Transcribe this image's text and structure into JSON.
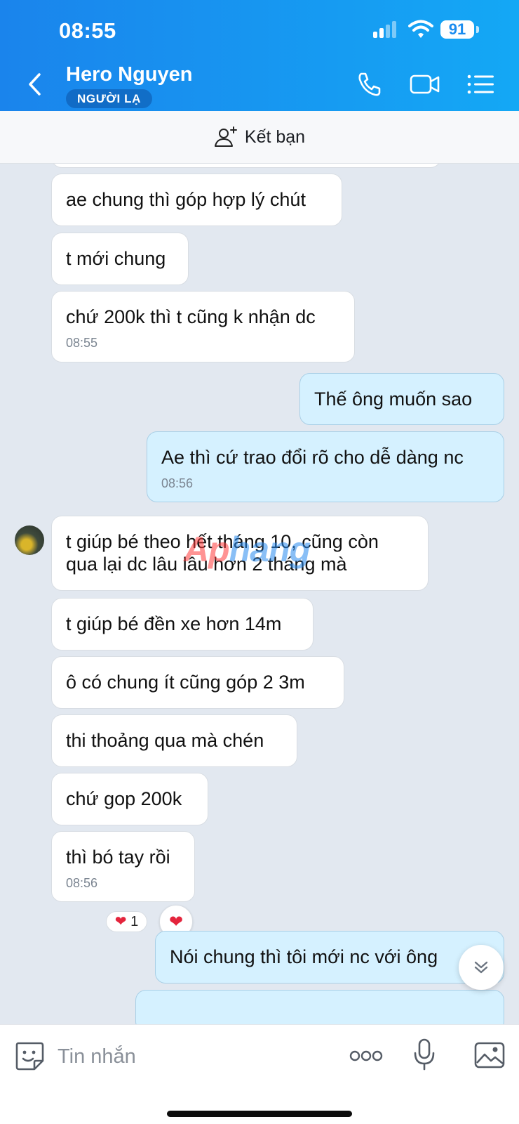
{
  "status_bar": {
    "time": "08:55",
    "battery": "91"
  },
  "header": {
    "contact_name": "Hero Nguyen",
    "badge": "NGƯỜI LẠ"
  },
  "add_friend": {
    "label": "Kết bạn"
  },
  "messages": [
    {
      "side": "in",
      "text": "ae chung thì góp hợp lý chút"
    },
    {
      "side": "in",
      "text": "t mới chung"
    },
    {
      "side": "in",
      "text": "chứ 200k thì t cũng k nhận dc",
      "time": "08:55"
    },
    {
      "side": "out",
      "text": "Thế ông muốn sao"
    },
    {
      "side": "out",
      "text": "Ae thì cứ trao đổi rõ cho dễ dàng nc",
      "time": "08:56"
    },
    {
      "side": "in",
      "text": "t giúp bé theo hết tháng 10, cũng còn",
      "text2": "qua lại dc lâu lâu hơn 2 tháng mà"
    },
    {
      "side": "in",
      "text": "t giúp bé đền xe hơn 14m"
    },
    {
      "side": "in",
      "text": "ô có chung ít cũng góp 2 3m"
    },
    {
      "side": "in",
      "text": "thi thoảng qua mà chén"
    },
    {
      "side": "in",
      "text": "chứ gop 200k"
    },
    {
      "side": "in",
      "text": "thì bó tay rồi",
      "time": "08:56"
    },
    {
      "side": "out",
      "text": "Nói chung thì tôi mới nc với ông"
    }
  ],
  "reaction": {
    "emoji": "❤️",
    "count": "1"
  },
  "watermark": {
    "part1": "Ap",
    "part2": "hang"
  },
  "input": {
    "placeholder": "Tin nhắn"
  },
  "icons": {
    "back": "chevron-left-icon",
    "call": "phone-icon",
    "video": "video-camera-icon",
    "menu": "list-menu-icon",
    "add_friend": "add-user-icon",
    "sticker": "sticker-smiley-icon",
    "more": "more-dots-icon",
    "mic": "microphone-icon",
    "image": "image-gallery-icon",
    "scroll": "chevron-double-down-icon"
  },
  "colors": {
    "header_start": "#1a84ec",
    "header_end": "#14a8f5",
    "chat_bg": "#e2e8f0",
    "incoming_bubble": "#ffffff",
    "outgoing_bubble": "#d5f1ff"
  }
}
